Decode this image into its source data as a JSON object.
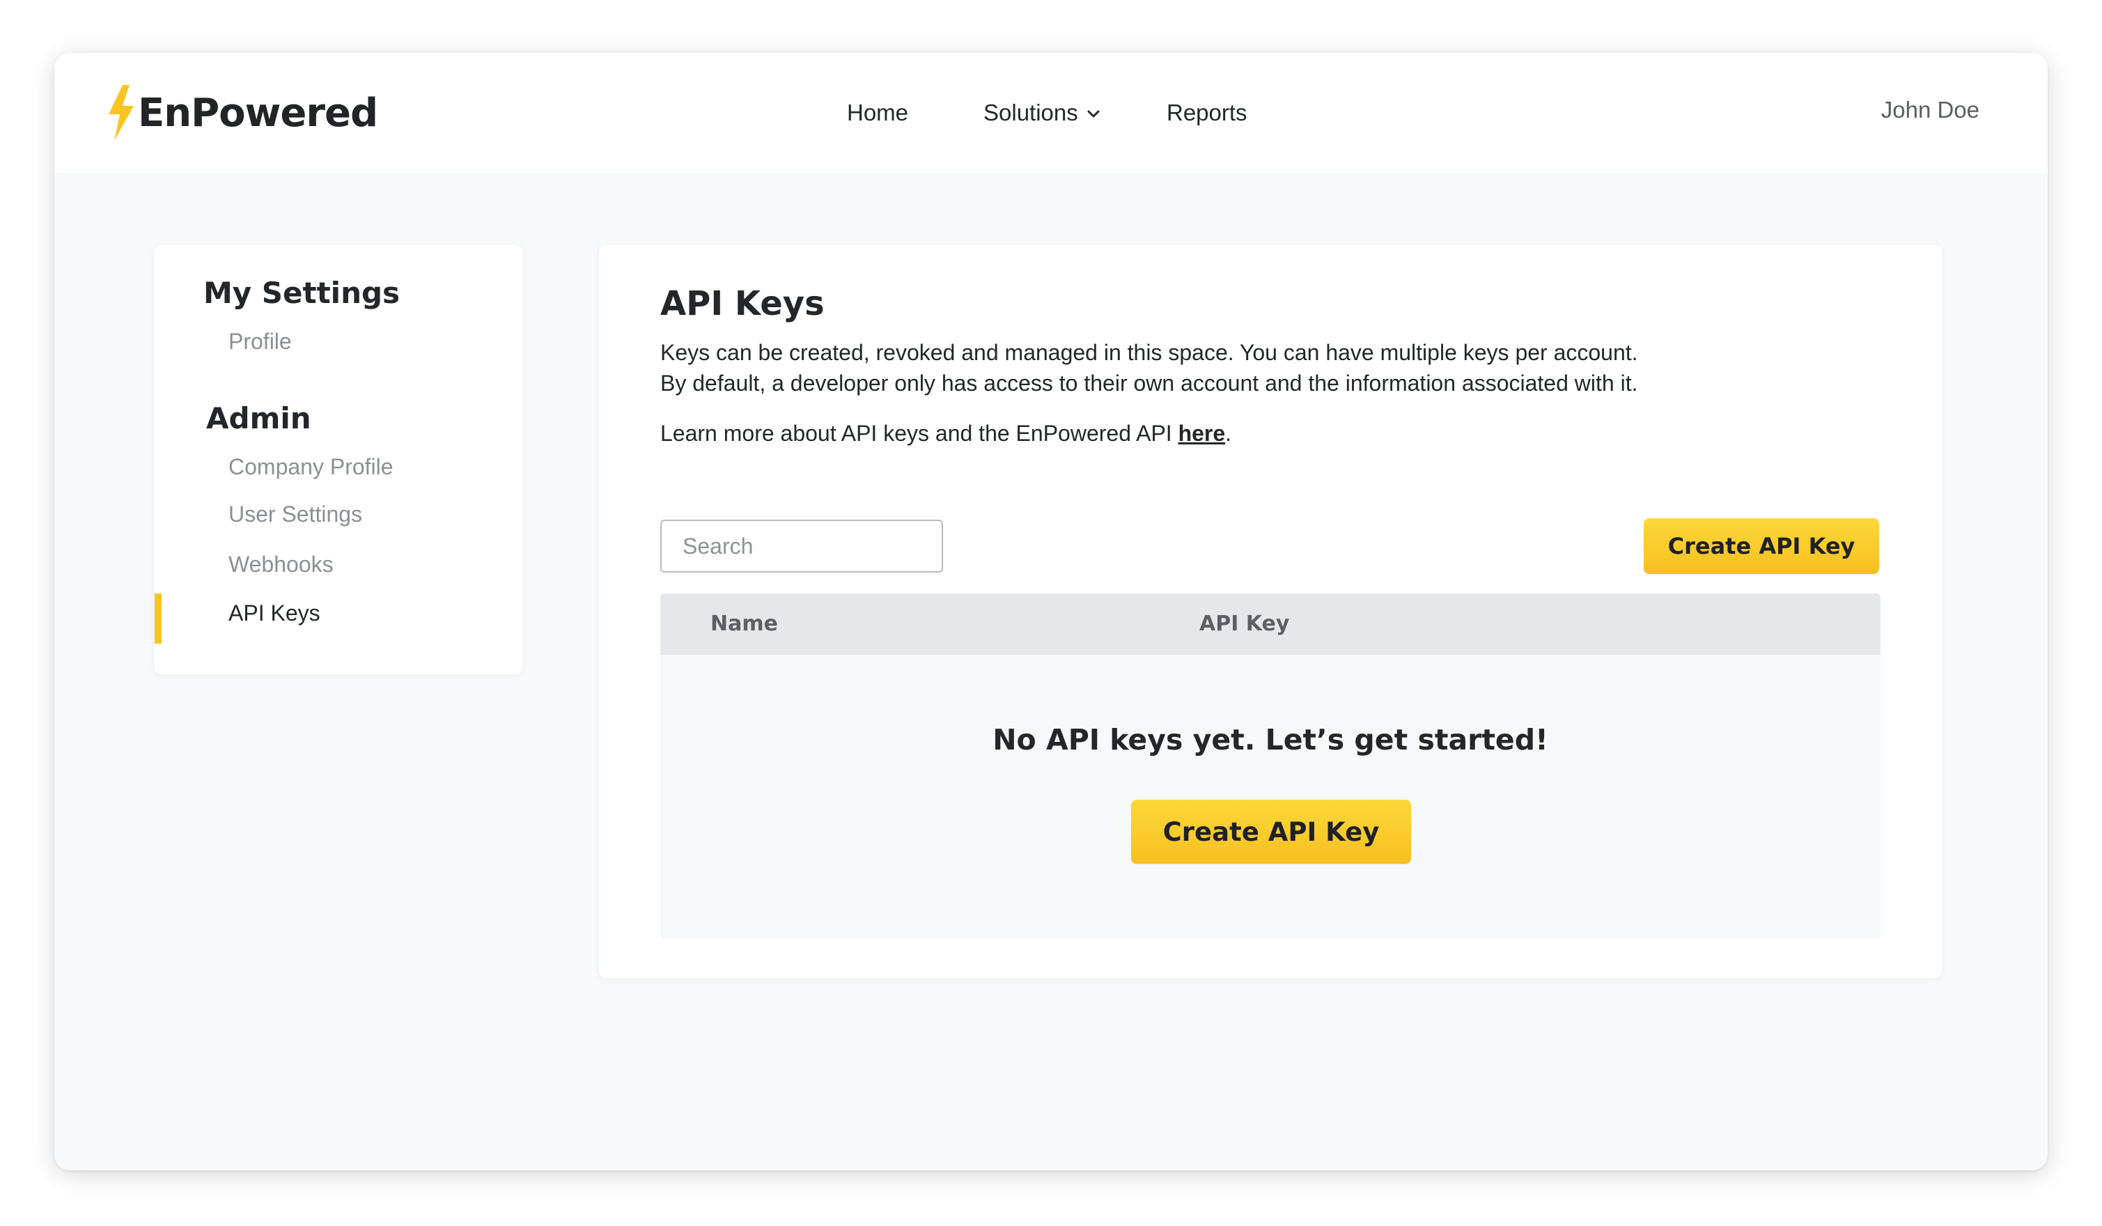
{
  "header": {
    "logo_text": "EnPowered",
    "logo_icon": "lightning-bolt-icon",
    "nav": {
      "home": "Home",
      "solutions": "Solutions",
      "reports": "Reports"
    },
    "user_name": "John Doe"
  },
  "sidebar": {
    "my_settings_heading": "My Settings",
    "my_settings_items": [
      "Profile"
    ],
    "admin_heading": "Admin",
    "admin_items": [
      "Company Profile",
      "User Settings",
      "Webhooks",
      "API Keys"
    ],
    "active_item": "API Keys"
  },
  "main": {
    "title": "API Keys",
    "description_line1": "Keys can be created, revoked and managed in this space. You can have multiple keys per account.",
    "description_line2": "By default, a developer only has access to their own account and the information associated with it.",
    "learn_more_prefix": "Learn more about API keys and the EnPowered API ",
    "learn_more_link": "here",
    "learn_more_suffix": ".",
    "search_placeholder": "Search",
    "search_value": "",
    "create_button": "Create API Key",
    "table": {
      "columns": [
        "Name",
        "API Key"
      ],
      "rows": []
    },
    "empty_state": {
      "title": "No API keys yet. Let’s get started!",
      "button": "Create API Key"
    }
  },
  "colors": {
    "accent": "#f9c523",
    "page_background": "#f8f9fb",
    "table_header": "#e6e7e9",
    "text_primary": "#23262b",
    "text_muted": "#8b8e94"
  }
}
